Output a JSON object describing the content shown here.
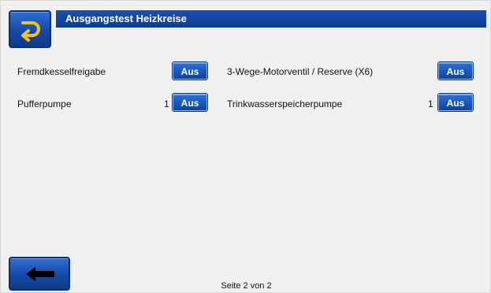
{
  "header": {
    "title": "Ausgangstest Heizkreise"
  },
  "outputs": {
    "left": [
      {
        "label": "Fremdkesselfreigabe",
        "value": "",
        "button": "Aus"
      },
      {
        "label": "Pufferpumpe",
        "value": "1",
        "button": "Aus"
      }
    ],
    "right": [
      {
        "label": "3-Wege-Motorventil / Reserve (X6)",
        "value": "",
        "button": "Aus"
      },
      {
        "label": "Trinkwasserspeicherpumpe",
        "value": "1",
        "button": "Aus"
      }
    ]
  },
  "footer": {
    "page": "Seite 2 von 2"
  },
  "icons": {
    "top": "return-arrow-icon",
    "bottom": "left-arrow-icon"
  },
  "colors": {
    "accent": "#1b4fb2",
    "button": "#1655b8",
    "background": "#f0f0f0"
  }
}
